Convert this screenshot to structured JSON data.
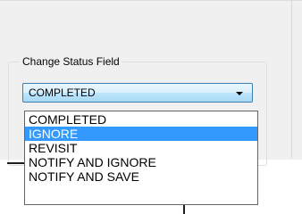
{
  "group": {
    "title": "Change Status Field"
  },
  "combo": {
    "value": "COMPLETED"
  },
  "dropdown": {
    "options": [
      "COMPLETED",
      "IGNORE",
      "REVISIT",
      "NOTIFY AND IGNORE",
      "NOTIFY AND SAVE"
    ],
    "highlighted_index": 1
  },
  "colors": {
    "highlight": "#3399ff",
    "combo_border": "#3c7fb1",
    "panel_bg": "#f0f0f0"
  }
}
